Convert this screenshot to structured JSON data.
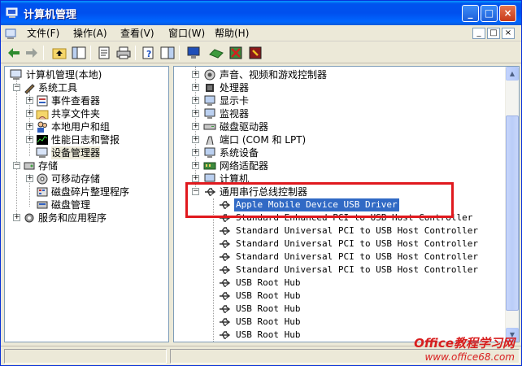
{
  "window": {
    "title": "计算机管理"
  },
  "menu": {
    "items": [
      "文件(F)",
      "操作(A)",
      "查看(V)",
      "窗口(W)",
      "帮助(H)"
    ],
    "mdi_controls": [
      "_",
      "□",
      "×"
    ]
  },
  "left_tree": {
    "root": "计算机管理(本地)",
    "system_tools": "系统工具",
    "event_viewer": "事件查看器",
    "shared_folders": "共享文件夹",
    "local_users": "本地用户和组",
    "perf_logs": "性能日志和警报",
    "device_manager": "设备管理器",
    "storage": "存储",
    "removable": "可移动存储",
    "defrag": "磁盘碎片整理程序",
    "disk_mgmt": "磁盘管理",
    "services": "服务和应用程序"
  },
  "right_tree": {
    "categories": [
      "声音、视频和游戏控制器",
      "处理器",
      "显示卡",
      "监视器",
      "磁盘驱动器",
      "端口 (COM 和 LPT)",
      "系统设备",
      "网络适配器",
      "计算机"
    ],
    "usb_category": "通用串行总线控制器",
    "usb_devices": [
      "Apple Mobile Device USB Driver",
      "Standard Enhanced PCI to USB Host Controller",
      "Standard Universal PCI to USB Host Controller",
      "Standard Universal PCI to USB Host Controller",
      "Standard Universal PCI to USB Host Controller",
      "Standard Universal PCI to USB Host Controller",
      "USB Root Hub",
      "USB Root Hub",
      "USB Root Hub",
      "USB Root Hub",
      "USB Root Hub"
    ]
  },
  "watermark": {
    "line1": "Office教程学习网",
    "line2": "www.office68.com"
  },
  "colors": {
    "titlebar": "#0053EE",
    "selection": "#316AC5",
    "highlight_box": "#E0191E"
  }
}
